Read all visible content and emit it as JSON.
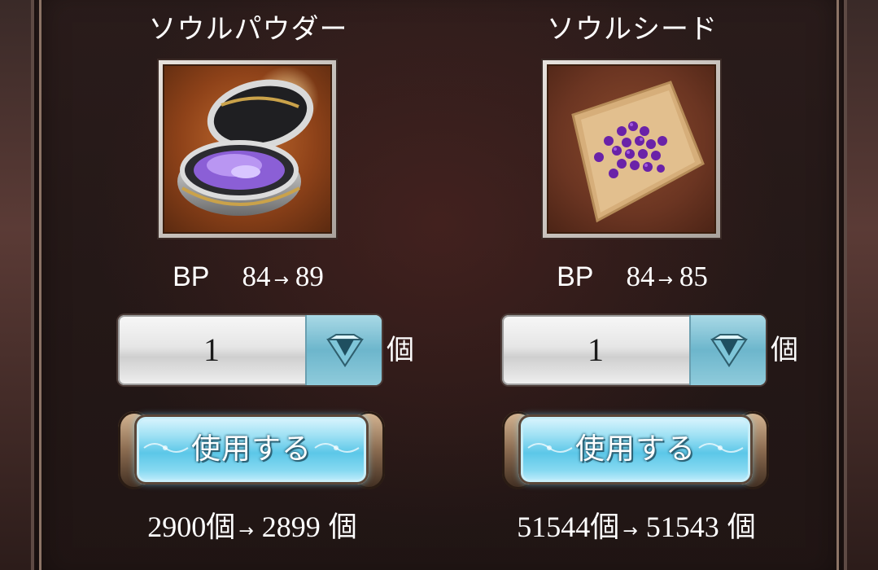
{
  "items": [
    {
      "name": "ソウルパウダー",
      "bp_label": "BP",
      "bp_from": "84",
      "arrow": "→",
      "bp_to": "89",
      "quantity": "1",
      "quantity_unit": "個",
      "use_label": "使用する",
      "stock_from": "2900個",
      "stock_to": "2899",
      "stock_unit": "個",
      "icon": "soul-powder-icon"
    },
    {
      "name": "ソウルシード",
      "bp_label": "BP",
      "bp_from": "84",
      "arrow": "→",
      "bp_to": "85",
      "quantity": "1",
      "quantity_unit": "個",
      "use_label": "使用する",
      "stock_from": "51544個",
      "stock_to": "51543",
      "stock_unit": "個",
      "icon": "soul-seed-icon"
    }
  ],
  "colors": {
    "dialog_bg": "#241817",
    "button_blue": "#5cc7e8",
    "dropdown_blue": "#6db6cc",
    "text": "#ffffff"
  }
}
